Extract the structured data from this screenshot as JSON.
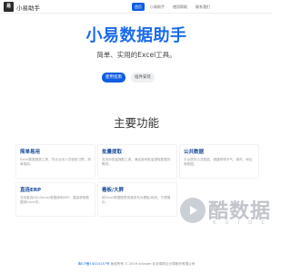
{
  "header": {
    "logo_text": "易",
    "brand": "小易助手",
    "nav": [
      {
        "label": "首页",
        "active": true
      },
      {
        "label": "小易助手",
        "active": false
      },
      {
        "label": "使用帮助",
        "active": false
      },
      {
        "label": "联系我们",
        "active": false
      }
    ]
  },
  "hero": {
    "title": "小易数据助手",
    "subtitle": "简单、实用的Excel工具。",
    "primary_button": "使用指南",
    "secondary_button": "插件安装"
  },
  "features": {
    "title": "主要功能",
    "cards": [
      {
        "title": "简单易用",
        "desc": "Excel数据报表工具，符合业务人员使用习惯，简单易用。"
      },
      {
        "title": "批量提取",
        "desc": "支持对批量提取工具，满足各种批量提取数据的需求。"
      },
      {
        "title": "公共数据",
        "desc": "平台提供公共数据，便捷获得天气、城市、地址等数据。"
      },
      {
        "title": "直连ERP",
        "desc": "支持直连SQLServer数据库和ERP，直接获取数据到Excel中。"
      },
      {
        "title": "看板/大屏",
        "desc": "将Excel数据图表快速发布为看板/网页，方便展示。"
      }
    ]
  },
  "watermark": {
    "text": "酷数据",
    "letters": "KUIDC"
  },
  "footer": {
    "icp": "粤ICP备14024137号",
    "copyright": "版权所有 © 2016 yixiaoer 北京易耐云计算股份有限公司"
  },
  "colors": {
    "accent": "#1a6bec",
    "primary_button": "#0f5de3",
    "card_title": "#1a4c9c"
  }
}
